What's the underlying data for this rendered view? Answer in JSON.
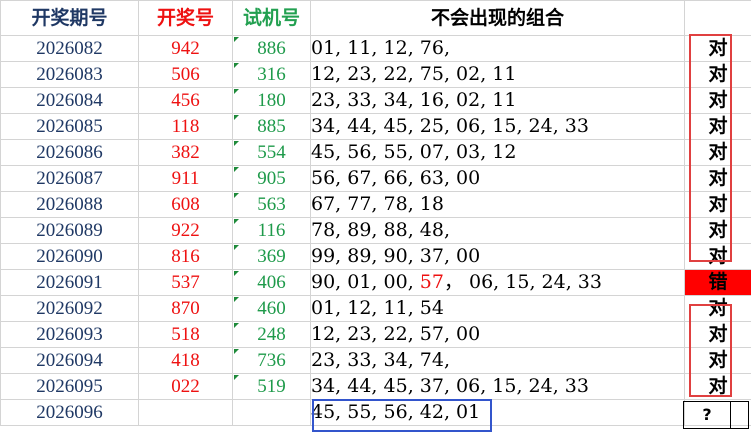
{
  "headers": {
    "period": "开奖期号",
    "draw": "开奖号",
    "trial": "试机号",
    "combo": "不会出现的组合",
    "result": ""
  },
  "colors": {
    "period_text": "#1f3864",
    "draw_text": "#ee1111",
    "trial_text": "#1e9a4a",
    "error_fill": "#ff0000",
    "box_red": "#e04040",
    "box_blue": "#3355cc"
  },
  "rows": [
    {
      "period": "2026082",
      "draw": "942",
      "trial": "886",
      "combo": "01, 11, 12, 76,",
      "result": "对"
    },
    {
      "period": "2026083",
      "draw": "506",
      "trial": "316",
      "combo": "12, 23, 22, 75, 02, 11",
      "result": "对"
    },
    {
      "period": "2026084",
      "draw": "456",
      "trial": "180",
      "combo": "23, 33, 34, 16, 02, 11",
      "result": "对"
    },
    {
      "period": "2026085",
      "draw": "118",
      "trial": "885",
      "combo": "34, 44, 45, 25, 06, 15, 24, 33",
      "result": "对"
    },
    {
      "period": "2026086",
      "draw": "382",
      "trial": "554",
      "combo": "45, 56, 55, 07, 03, 12",
      "result": "对"
    },
    {
      "period": "2026087",
      "draw": "911",
      "trial": "905",
      "combo": "56, 67, 66, 63, 00",
      "result": "对"
    },
    {
      "period": "2026088",
      "draw": "608",
      "trial": "563",
      "combo": "67, 77, 78, 18",
      "result": "对"
    },
    {
      "period": "2026089",
      "draw": "922",
      "trial": "116",
      "combo": "78, 89, 88, 48,",
      "result": "对"
    },
    {
      "period": "2026090",
      "draw": "816",
      "trial": "369",
      "combo": "99, 89, 90, 37, 00",
      "result": "对"
    },
    {
      "period": "2026091",
      "draw": "537",
      "trial": "406",
      "combo_pre": "90, 01, 00, ",
      "combo_hi": "57",
      "combo_post": "， 06, 15, 24, 33",
      "result": "错"
    },
    {
      "period": "2026092",
      "draw": "870",
      "trial": "460",
      "combo": "01, 12, 11, 54",
      "result": "对"
    },
    {
      "period": "2026093",
      "draw": "518",
      "trial": "248",
      "combo": "12, 23, 22, 57, 00",
      "result": "对"
    },
    {
      "period": "2026094",
      "draw": "418",
      "trial": "736",
      "combo": "23, 33, 34, 74,",
      "result": "对"
    },
    {
      "period": "2026095",
      "draw": "022",
      "trial": "519",
      "combo": "34, 44, 45, 37, 06, 15, 24, 33",
      "result": "对"
    },
    {
      "period": "2026096",
      "draw": "",
      "trial": "",
      "combo": "45, 55, 56, 42, 01",
      "result": "?"
    }
  ]
}
